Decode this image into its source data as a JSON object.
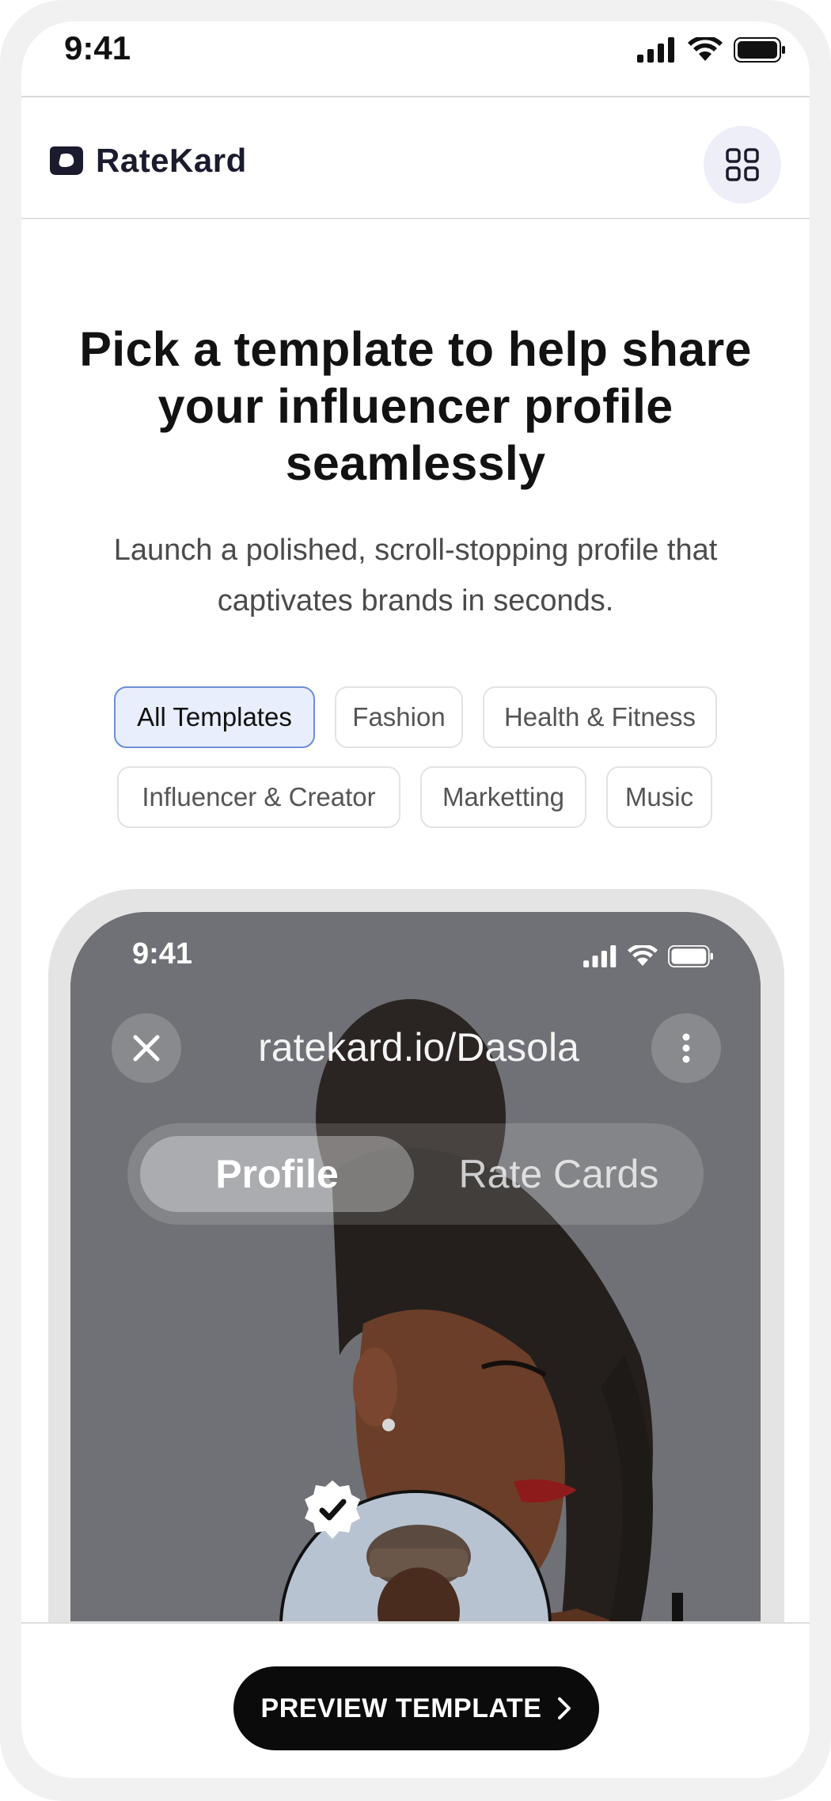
{
  "status_bar": {
    "time": "9:41"
  },
  "header": {
    "brand": "RateKard",
    "brand_icon": "ratekard-logo-icon",
    "menu_icon": "grid-icon"
  },
  "hero": {
    "headline": "Pick a template to help share your influencer profile seamlessly",
    "subheadline": "Launch a polished, scroll-stopping profile that captivates brands in seconds."
  },
  "filters": {
    "items": [
      {
        "label": "All Templates",
        "active": true
      },
      {
        "label": "Fashion",
        "active": false
      },
      {
        "label": "Health & Fitness",
        "active": false
      },
      {
        "label": "Influencer & Creator",
        "active": false
      },
      {
        "label": "Marketting",
        "active": false
      },
      {
        "label": "Music",
        "active": false
      }
    ]
  },
  "preview": {
    "time": "9:41",
    "url": "ratekard.io/Dasola",
    "tabs": [
      {
        "label": "Profile",
        "active": true
      },
      {
        "label": "Rate Cards",
        "active": false
      }
    ],
    "close_icon": "close-icon",
    "more_icon": "more-vertical-icon",
    "badge_icon": "verified-check-icon"
  },
  "cta": {
    "label": "PREVIEW TEMPLATE",
    "icon": "chevron-right-icon"
  },
  "colors": {
    "accent_chip_bg": "#e8eefb",
    "accent_chip_border": "#6b8fd6",
    "cta_bg": "#0b0b0b",
    "menu_btn_bg": "#eeeef9"
  }
}
